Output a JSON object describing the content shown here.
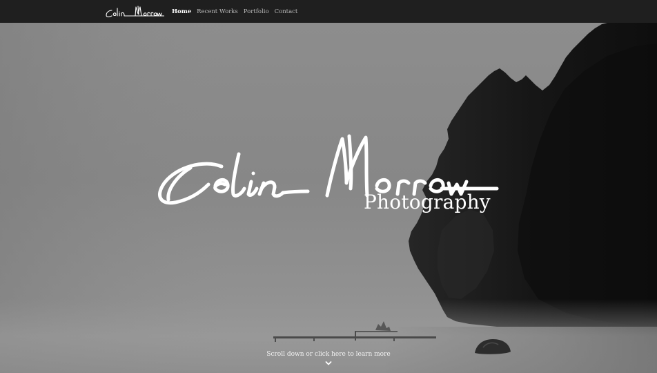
{
  "site": {
    "logo_signature": "Colin Morrow",
    "tagline": "Photography"
  },
  "nav": {
    "items": [
      {
        "label": "Home",
        "active": true
      },
      {
        "label": "Recent Works",
        "active": false
      },
      {
        "label": "Portfolio",
        "active": false
      },
      {
        "label": "Contact",
        "active": false
      }
    ]
  },
  "hero": {
    "scroll_text": "Scroll down or click here to learn more",
    "scroll_icon": "chevron-down-icon"
  },
  "colors": {
    "topbar": "#1f1f1f",
    "nav_active": "#ffffff",
    "nav_inactive": "#b9b9b9",
    "fog": "#8d8d8d",
    "trees": "#151515"
  }
}
